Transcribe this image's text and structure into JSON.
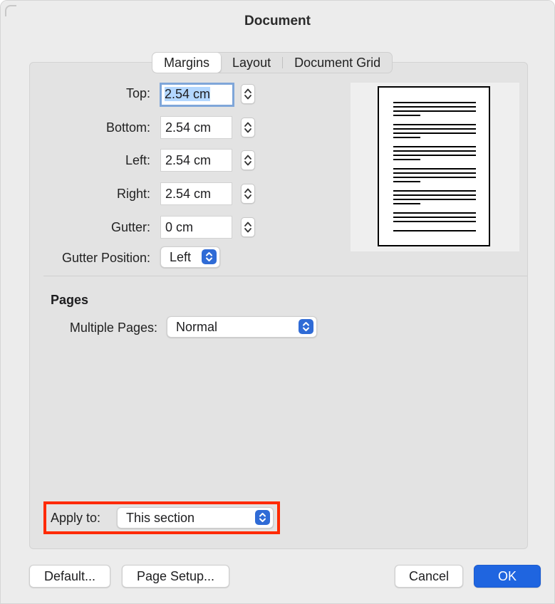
{
  "window": {
    "title": "Document"
  },
  "tabs": [
    {
      "label": "Margins",
      "selected": true
    },
    {
      "label": "Layout",
      "selected": false
    },
    {
      "label": "Document Grid",
      "selected": false
    }
  ],
  "margins": {
    "top": {
      "label": "Top:",
      "value": "2.54 cm"
    },
    "bottom": {
      "label": "Bottom:",
      "value": "2.54 cm"
    },
    "left": {
      "label": "Left:",
      "value": "2.54 cm"
    },
    "right": {
      "label": "Right:",
      "value": "2.54 cm"
    },
    "gutter": {
      "label": "Gutter:",
      "value": "0 cm"
    },
    "gutter_position": {
      "label": "Gutter Position:",
      "value": "Left"
    }
  },
  "pages": {
    "title": "Pages",
    "multiple_pages": {
      "label": "Multiple Pages:",
      "value": "Normal"
    }
  },
  "apply_to": {
    "label": "Apply to:",
    "value": "This section"
  },
  "buttons": {
    "default": "Default...",
    "page_setup": "Page Setup...",
    "cancel": "Cancel",
    "ok": "OK"
  },
  "colors": {
    "accent": "#1f65e0",
    "focus_ring": "#7fa6d9",
    "highlight_box": "#ff2a00"
  }
}
